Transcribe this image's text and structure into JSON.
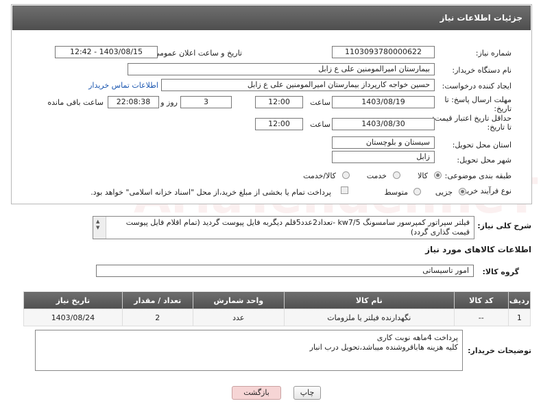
{
  "header": {
    "title": "جزئیات اطلاعات نیاز"
  },
  "fields": {
    "need_number_label": "شماره نیاز:",
    "need_number": "1103093780000622",
    "announce_label": "تاریخ و ساعت اعلان عمومی:",
    "announce_value": "1403/08/15 - 12:42",
    "buyer_org_label": "نام دستگاه خریدار:",
    "buyer_org": "بیمارستان امیرالمومنین علی  ع  زابل",
    "creator_label": "ایجاد کننده درخواست:",
    "creator": "حسین خواجه کارپرداز بیمارستان امیرالمومنین علی  ع  زابل",
    "contact_link": "اطلاعات تماس خریدار",
    "reply_deadline_label": "مهلت ارسال پاسخ: تا تاریخ:",
    "reply_date": "1403/08/19",
    "time_label": "ساعت",
    "reply_time": "12:00",
    "days_value": "3",
    "days_label": "روز و",
    "remaining_time": "22:08:38",
    "remaining_label": "ساعت باقی مانده",
    "price_validity_label": "حداقل تاریخ اعتبار قیمت: تا تاریخ:",
    "price_date": "1403/08/30",
    "price_time": "12:00",
    "province_label": "استان محل تحویل:",
    "province": "سیستان و بلوچستان",
    "city_label": "شهر محل تحویل:",
    "city": "زابل",
    "category_label": "طبقه بندی موضوعی:",
    "category_options": [
      "کالا",
      "خدمت",
      "کالا/خدمت"
    ],
    "process_label": "نوع فرآیند خرید :",
    "process_options": [
      "جزیی",
      "متوسط"
    ],
    "payment_note": "پرداخت تمام یا بخشی از مبلغ خرید،از محل \"اسناد خزانه اسلامی\" خواهد بود."
  },
  "description": {
    "label": "شرح کلی نیاز:",
    "text": "فیلتر سپراتور کمپرسور سامسونگ  kw7/5  -تعداد2عدد5قلم دیگربه فایل پیوست گردید (تمام اقلام فایل پیوست قیمت گذاری گردد)"
  },
  "goods_info": {
    "section_title": "اطلاعات کالاهای مورد نیاز",
    "group_label": "گروه کالا:",
    "group_value": "امور تاسیساتی"
  },
  "table": {
    "headers": [
      "ردیف",
      "کد کالا",
      "نام کالا",
      "واحد شمارش",
      "تعداد / مقدار",
      "تاریخ نیاز"
    ],
    "rows": [
      [
        "1",
        "--",
        "نگهدارنده فیلتر یا ملزومات",
        "عدد",
        "2",
        "1403/08/24"
      ]
    ]
  },
  "buyer_notes": {
    "label": "توضیحات خریدار:",
    "line1": "پرداخت 4ماهه نوبت کاری",
    "line2": "کلیه هزینه هاباقروشنده میباشد،تحویل درب انبار"
  },
  "buttons": {
    "print": "چاپ",
    "back": "بازگشت"
  },
  "colors": {
    "header_bg": "#5a5a5a",
    "link": "#1a56b0",
    "back_btn": "#f6d5d5"
  }
}
